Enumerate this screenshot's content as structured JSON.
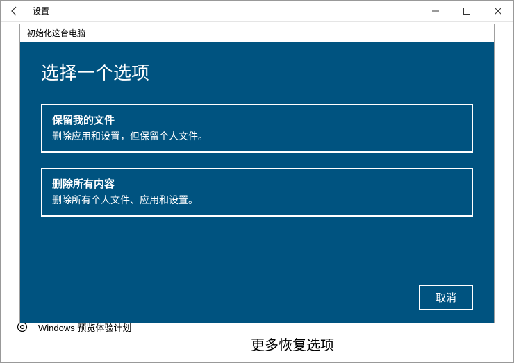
{
  "titlebar": {
    "title": "设置"
  },
  "sidebar": {
    "windows_insider_label": "Windows 预览体验计划"
  },
  "main": {
    "more_recovery_label": "更多恢复选项"
  },
  "dialog": {
    "window_title": "初始化这台电脑",
    "heading": "选择一个选项",
    "options": [
      {
        "title": "保留我的文件",
        "desc": "删除应用和设置，但保留个人文件。"
      },
      {
        "title": "删除所有内容",
        "desc": "删除所有个人文件、应用和设置。"
      }
    ],
    "cancel_label": "取消"
  }
}
